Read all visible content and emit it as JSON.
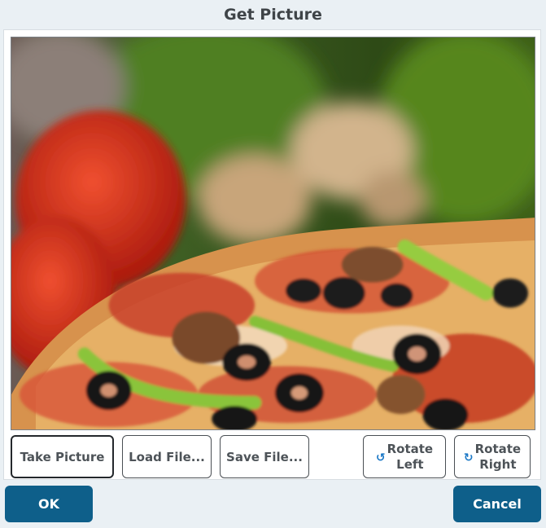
{
  "dialog": {
    "title": "Get Picture"
  },
  "image": {
    "subject": "pizza-photo"
  },
  "buttons": {
    "take_picture": "Take Picture",
    "load_file": "Load File...",
    "save_file": "Save File...",
    "rotate_left_line1": "Rotate",
    "rotate_left_line2": "Left",
    "rotate_right_line1": "Rotate",
    "rotate_right_line2": "Right",
    "rotate_left_icon": "rotate-left-icon",
    "rotate_right_icon": "rotate-right-icon"
  },
  "footer": {
    "ok": "OK",
    "cancel": "Cancel"
  },
  "colors": {
    "accent": "#0e5f8a",
    "background": "#eaf0f4",
    "icon_blue": "#1b78c6"
  }
}
